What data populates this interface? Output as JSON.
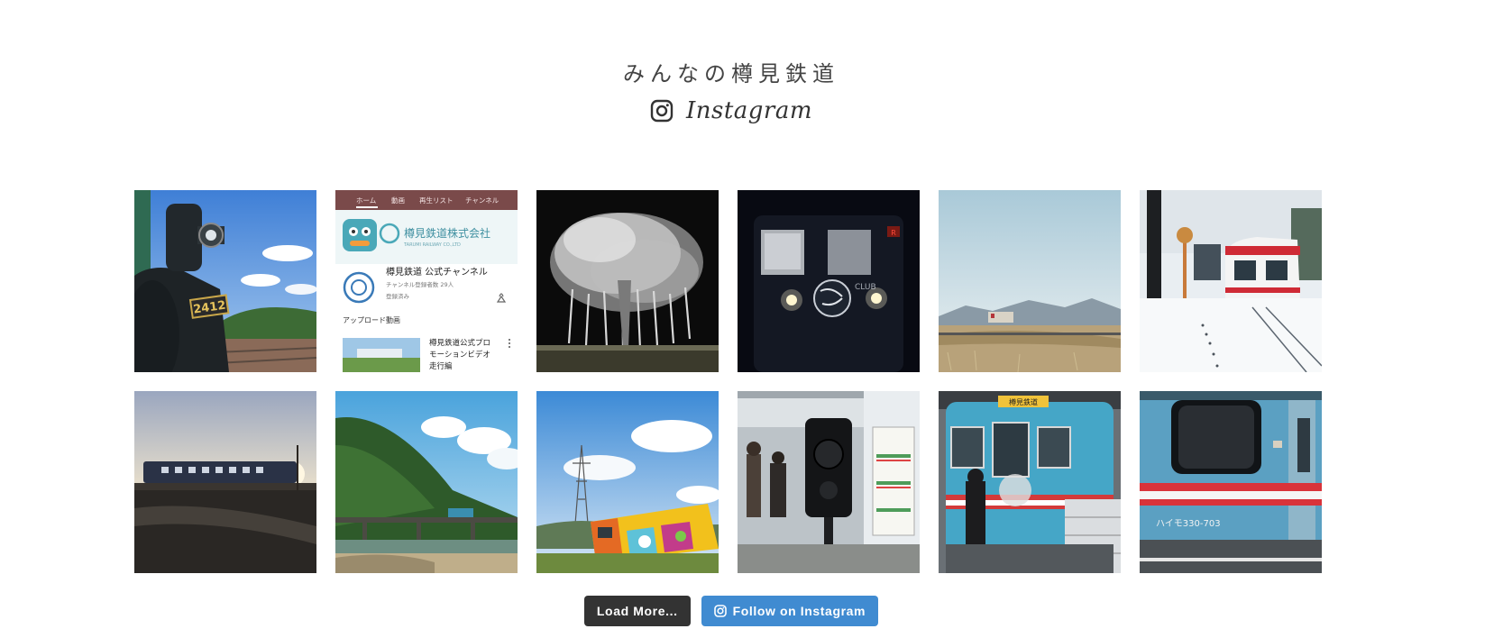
{
  "header": {
    "title": "みんなの樽見鉄道",
    "instagram_label": "Instagram"
  },
  "feed": {
    "tiles": [
      {
        "name": "steam-locomotive-2412-photo",
        "overlay_text": "2412"
      },
      {
        "name": "youtube-channel-screenshot-photo",
        "tabs": [
          "ホーム",
          "動画",
          "再生リスト",
          "チャンネル"
        ],
        "company": "樽見鉄道株式会社",
        "company_sub": "TARUMI RAILWAY CO.,LTD",
        "channel": "樽見鉄道 公式チャンネル",
        "subscribers": "チャンネル登録者数 29人",
        "subscribed": "登録済み",
        "uploads": "アップロード動画",
        "video_title_1": "樽見鉄道公式プロ",
        "video_title_2": "モーションビデオ",
        "video_title_3": "走行編"
      },
      {
        "name": "night-cherry-tree-photo"
      },
      {
        "name": "train-front-night-photo"
      },
      {
        "name": "train-rural-field-photo"
      },
      {
        "name": "snowy-station-train-photo"
      },
      {
        "name": "train-sunset-silhouette-photo"
      },
      {
        "name": "train-bridge-mountain-photo"
      },
      {
        "name": "painted-train-field-photo"
      },
      {
        "name": "train-interior-speaker-photo"
      },
      {
        "name": "blue-train-depot-photo",
        "sign_text": "樽見鉄道"
      },
      {
        "name": "haimo-train-closeup-photo",
        "car_number": "ハイモ330-703"
      }
    ]
  },
  "buttons": {
    "load_more": "Load More...",
    "follow": "Follow on Instagram"
  },
  "colors": {
    "load_more_bg": "#333333",
    "follow_bg": "#408bd1"
  },
  "icons": {
    "instagram": "instagram-icon"
  }
}
